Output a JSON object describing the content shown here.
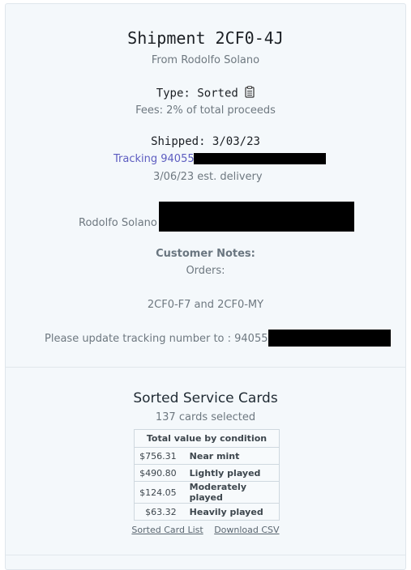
{
  "shipment": {
    "title": "Shipment 2CF0-4J",
    "from": "From Rodolfo Solano",
    "type": "Type: Sorted",
    "type_icon": "clipboard-icon",
    "fees": "Fees: 2% of total proceeds",
    "shipped": "Shipped: 3/03/23",
    "tracking": "Tracking 940550",
    "est_delivery": "3/06/23 est. delivery",
    "recipient": "Rodolfo Solano"
  },
  "notes": {
    "title": "Customer Notes:",
    "orders_label": "Orders:",
    "order_ids": "2CF0-F7 and 2CF0-MY",
    "update_text": "Please update tracking number to : 9405509"
  },
  "service": {
    "title": "Sorted Service Cards",
    "count": "137 cards selected",
    "table_header": "Total value by condition",
    "rows": [
      {
        "value": "$756.31",
        "condition": "Near mint"
      },
      {
        "value": "$490.80",
        "condition": "Lightly played"
      },
      {
        "value": "$124.05",
        "condition": "Moderately played"
      },
      {
        "value": "$63.32",
        "condition": "Heavily played"
      }
    ],
    "link_list": "Sorted Card List",
    "link_csv": "Download CSV"
  }
}
